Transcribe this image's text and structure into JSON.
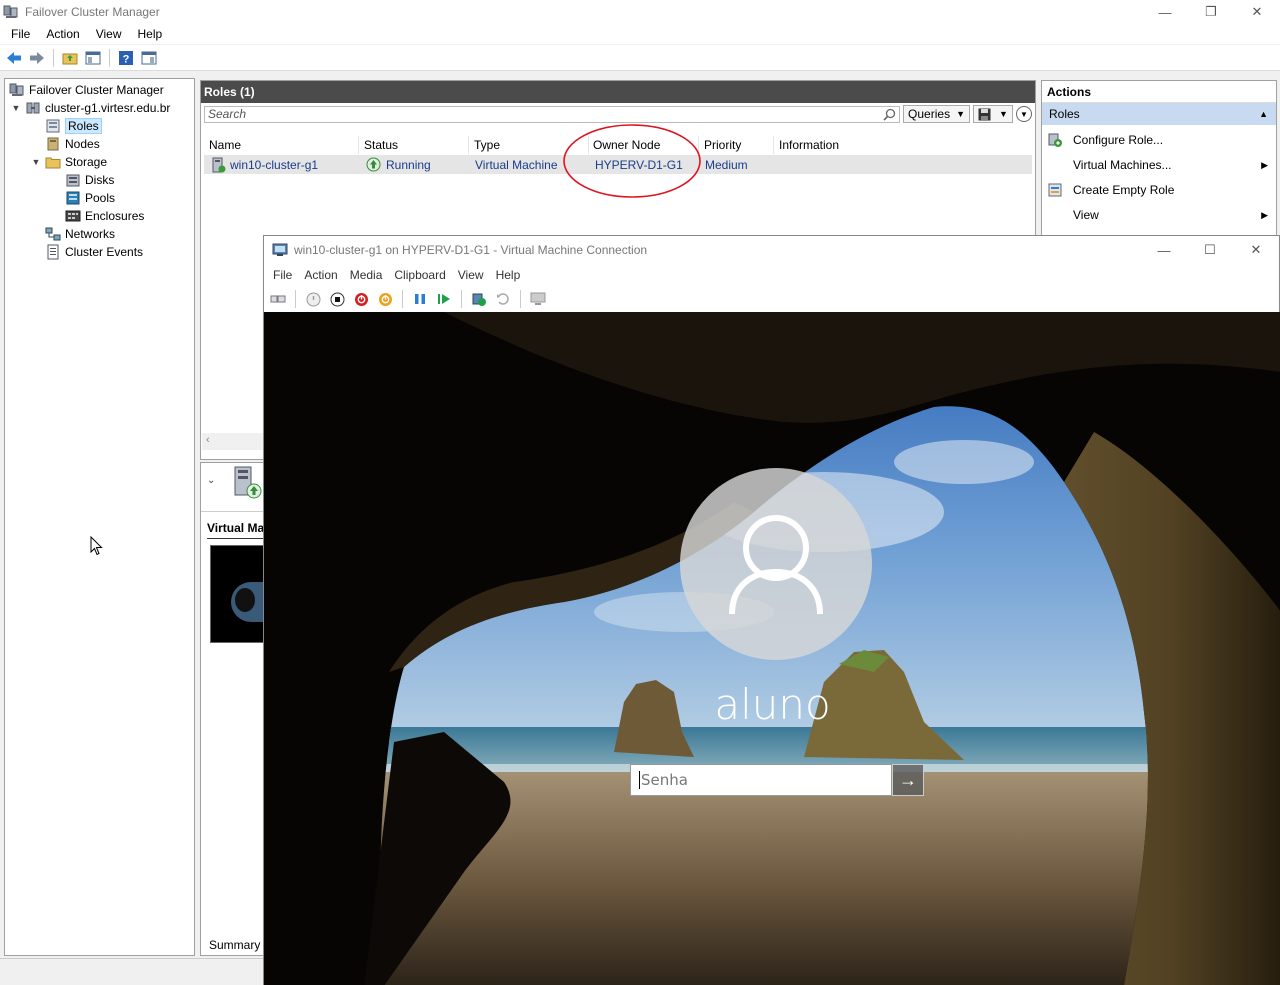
{
  "window": {
    "title": "Failover Cluster Manager",
    "menu": [
      "File",
      "Action",
      "View",
      "Help"
    ]
  },
  "tree": {
    "root": "Failover Cluster Manager",
    "cluster": "cluster-g1.virtesr.edu.br",
    "items": {
      "roles": "Roles",
      "nodes": "Nodes",
      "storage": "Storage",
      "disks": "Disks",
      "pools": "Pools",
      "enclosures": "Enclosures",
      "networks": "Networks",
      "cluster_events": "Cluster Events"
    }
  },
  "roles_pane": {
    "header": "Roles (1)",
    "search_placeholder": "Search",
    "queries_label": "Queries",
    "columns": [
      "Name",
      "Status",
      "Type",
      "Owner Node",
      "Priority",
      "Information"
    ],
    "rows": [
      {
        "name": "win10-cluster-g1",
        "status": "Running",
        "type": "Virtual Machine",
        "owner_node": "HYPERV-D1-G1",
        "priority": "Medium",
        "information": ""
      }
    ],
    "highlight_color": "#e0141e"
  },
  "lower_pane": {
    "section_label": "Virtual Ma",
    "summary_tab": "Summary"
  },
  "actions_pane": {
    "title": "Actions",
    "subheader": "Roles",
    "items": [
      "Configure Role...",
      "Virtual Machines...",
      "Create Empty Role",
      "View"
    ]
  },
  "vm_window": {
    "title": "win10-cluster-g1 on HYPERV-D1-G1 - Virtual Machine Connection",
    "menu": [
      "File",
      "Action",
      "Media",
      "Clipboard",
      "View",
      "Help"
    ],
    "login": {
      "username": "aluno",
      "password_placeholder": "Senha"
    }
  },
  "colors": {
    "selection": "#cce8ff",
    "roles_header_bg": "#4b4b4b",
    "actions_sub_bg": "#c8daf0",
    "link_text": "#1a3c8a"
  }
}
